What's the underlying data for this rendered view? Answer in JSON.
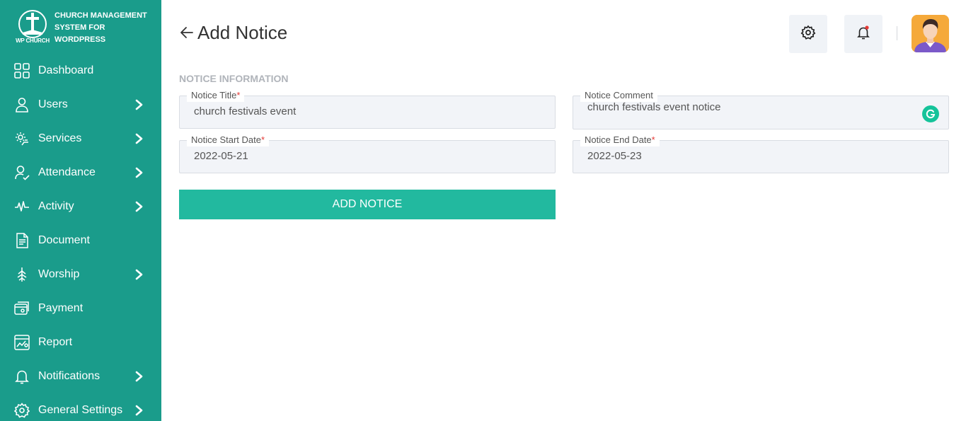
{
  "brand": {
    "logo_text": "WP CHURCH",
    "name": "CHURCH MANAGEMENT SYSTEM FOR WORDPRESS"
  },
  "sidebar": {
    "items": [
      {
        "label": "Dashboard",
        "icon": "dashboard-icon",
        "has_submenu": false
      },
      {
        "label": "Users",
        "icon": "user-icon",
        "has_submenu": true
      },
      {
        "label": "Services",
        "icon": "services-icon",
        "has_submenu": true
      },
      {
        "label": "Attendance",
        "icon": "attendance-icon",
        "has_submenu": true
      },
      {
        "label": "Activity",
        "icon": "activity-icon",
        "has_submenu": true
      },
      {
        "label": "Document",
        "icon": "document-icon",
        "has_submenu": false
      },
      {
        "label": "Worship",
        "icon": "worship-icon",
        "has_submenu": true
      },
      {
        "label": "Payment",
        "icon": "payment-icon",
        "has_submenu": false
      },
      {
        "label": "Report",
        "icon": "report-icon",
        "has_submenu": false
      },
      {
        "label": "Notifications",
        "icon": "bell-icon",
        "has_submenu": true
      },
      {
        "label": "General Settings",
        "icon": "gear-icon",
        "has_submenu": true
      }
    ]
  },
  "header": {
    "title": "Add Notice"
  },
  "form": {
    "section_title": "NOTICE INFORMATION",
    "notice_title": {
      "label": "Notice Title",
      "required": "*",
      "value": "church festivals event"
    },
    "notice_comment": {
      "label": "Notice Comment",
      "value": "church festivals event notice"
    },
    "notice_start_date": {
      "label": "Notice Start Date",
      "required": "*",
      "value": "2022-05-21"
    },
    "notice_end_date": {
      "label": "Notice End Date",
      "required": "*",
      "value": "2022-05-23"
    },
    "submit_label": "ADD NOTICE"
  },
  "colors": {
    "sidebar_bg": "#1a9c8b",
    "button_bg": "#22b99f",
    "required": "#e53935",
    "notification_dot": "#e53935",
    "avatar_bg": "#f5a93a"
  }
}
